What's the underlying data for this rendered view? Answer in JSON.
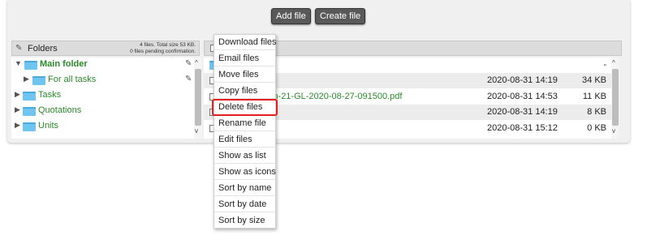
{
  "toolbar": {
    "add_label": "Add file",
    "create_label": "Create file"
  },
  "folders": {
    "header": "Folders",
    "stats_line1": "4 files. Total size 53 KB.",
    "stats_line2": "0 files pending confirmation.",
    "tree": [
      {
        "label": "Main folder",
        "expanded": true
      },
      {
        "label": "For all tasks",
        "expanded": false
      },
      {
        "label": "Tasks",
        "expanded": false
      },
      {
        "label": "Quotations",
        "expanded": false
      },
      {
        "label": "Units",
        "expanded": false
      }
    ]
  },
  "files": {
    "parent_row": {
      "size": "-"
    },
    "rows": [
      {
        "name": "",
        "date": "2020-08-31 14:19",
        "size": "34 KB"
      },
      {
        "name": "tt-Construction-21-GL-2020-08-27-091500.pdf",
        "date": "2020-08-31 14:53",
        "size": "11 KB"
      },
      {
        "name": "",
        "date": "2020-08-31 14:19",
        "size": "8 KB"
      },
      {
        "name": "",
        "date": "2020-08-31 15:12",
        "size": "0 KB"
      }
    ]
  },
  "context_menu": {
    "items": [
      "Download files",
      "Email files",
      "Move files",
      "Copy files",
      "Delete files",
      "Rename file",
      "Edit files",
      "Show as list",
      "Show as icons",
      "Sort by name",
      "Sort by date",
      "Sort by size"
    ],
    "highlighted": "Delete files"
  },
  "colors": {
    "link_green": "#2a8a2a",
    "highlight_red": "#e32020",
    "button_bg": "#595959"
  },
  "icons": [
    "pencil-icon",
    "folder-icon",
    "expand-triangle-icon",
    "scroll-up-icon",
    "scroll-down-icon"
  ]
}
